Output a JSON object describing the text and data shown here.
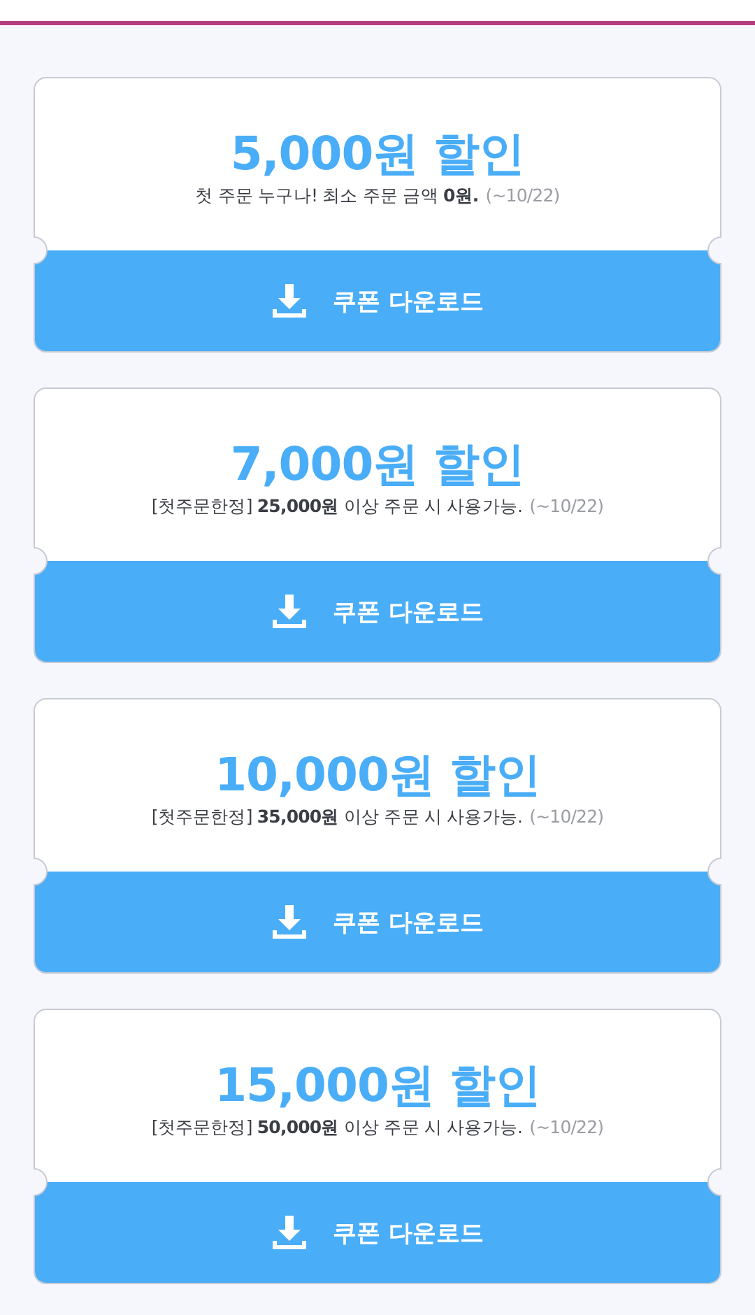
{
  "coupons": [
    {
      "amount": "5,000원 할인",
      "description": "첫 주문 누구나! 최소 주문 금액 **0원.**",
      "period": "(~10/22)",
      "button": "쿠폰 다운로드"
    },
    {
      "amount": "7,000원 할인",
      "description": "[첫주문한정] **25,000원** 이상 주문 시 사용가능.",
      "period": "(~10/22)",
      "button": "쿠폰 다운로드"
    },
    {
      "amount": "10,000원 할인",
      "description": "[첫주문한정] **35,000원** 이상 주문 시 사용가능.",
      "period": "(~10/22)",
      "button": "쿠폰 다운로드"
    },
    {
      "amount": "15,000원 할인",
      "description": "[첫주문한정] **50,000원** 이상 주문 시 사용가능.",
      "period": "(~10/22)",
      "button": "쿠폰 다운로드"
    }
  ]
}
